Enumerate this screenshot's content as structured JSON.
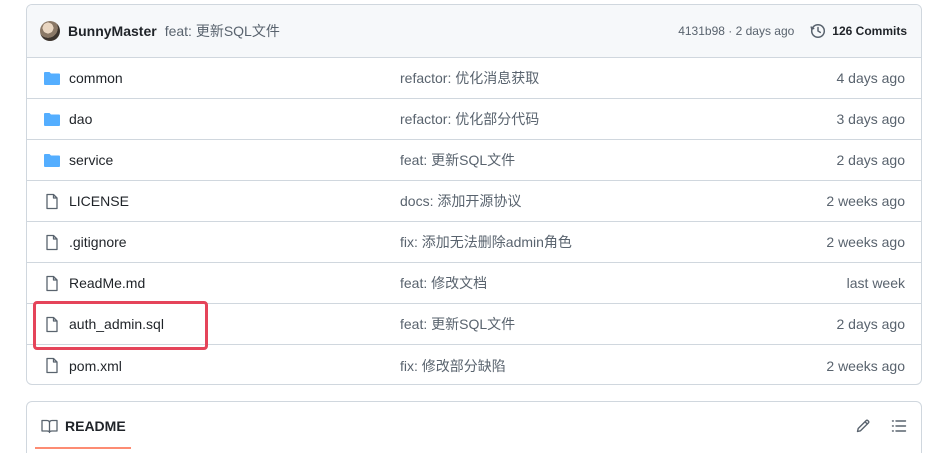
{
  "commit": {
    "author": "BunnyMaster",
    "message": "feat: 更新SQL文件",
    "meta": "4131b98 · 2 days ago",
    "commits_label": "126 Commits"
  },
  "files": [
    {
      "name": "common",
      "type": "folder",
      "message": "refactor: 优化消息获取",
      "age": "4 days ago"
    },
    {
      "name": "dao",
      "type": "folder",
      "message": "refactor: 优化部分代码",
      "age": "3 days ago"
    },
    {
      "name": "service",
      "type": "folder",
      "message": "feat: 更新SQL文件",
      "age": "2 days ago"
    },
    {
      "name": "LICENSE",
      "type": "file",
      "message": "docs: 添加开源协议",
      "age": "2 weeks ago"
    },
    {
      "name": ".gitignore",
      "type": "file",
      "message": "fix: 添加无法删除admin角色",
      "age": "2 weeks ago"
    },
    {
      "name": "ReadMe.md",
      "type": "file",
      "message": "feat: 修改文档",
      "age": "last week"
    },
    {
      "name": "auth_admin.sql",
      "type": "file",
      "message": "feat: 更新SQL文件",
      "age": "2 days ago"
    },
    {
      "name": "pom.xml",
      "type": "file",
      "message": "fix: 修改部分缺陷",
      "age": "2 weeks ago"
    }
  ],
  "readme": {
    "tab_label": "README"
  },
  "colors": {
    "folder": "#54aeff",
    "highlight": "#e5445a",
    "tab_underline": "#fd8c73"
  }
}
